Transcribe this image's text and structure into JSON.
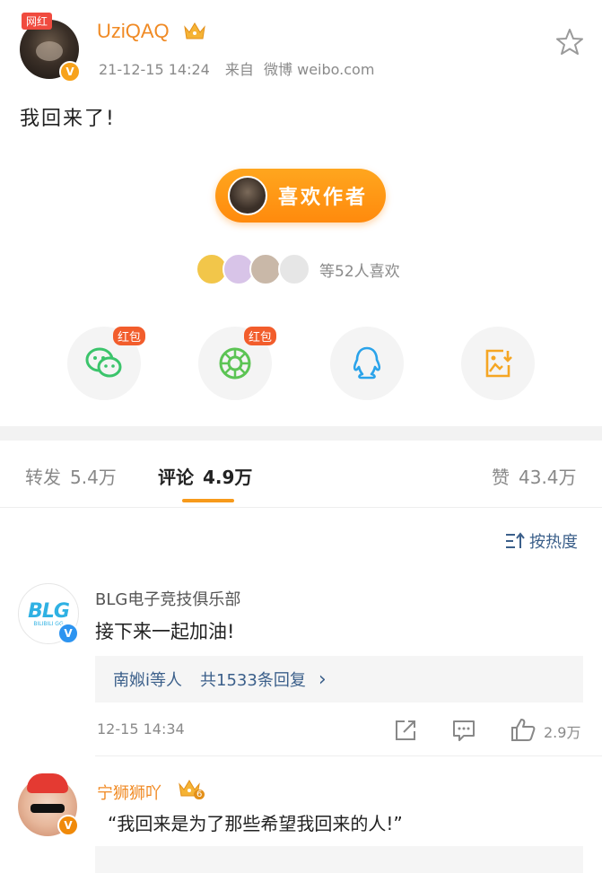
{
  "post": {
    "badge": "网红",
    "username": "UziQAQ",
    "datetime": "21-12-15 14:24",
    "source_prefix": "来自",
    "source": "微博 weibo.com",
    "text": "我回来了!",
    "like_author_label": "喜欢作者",
    "likers_text": "等52人喜欢",
    "hongbao_label_1": "红包",
    "hongbao_label_2": "红包",
    "verified_mark": "V"
  },
  "tabs": [
    {
      "label": "转发",
      "count": "5.4万"
    },
    {
      "label": "评论",
      "count": "4.9万"
    },
    {
      "label": "赞",
      "count": "43.4万"
    }
  ],
  "sort_label": "按热度",
  "comments": [
    {
      "name": "BLG电子竞技俱乐部",
      "logo_text": "BLG",
      "logo_sub": "BILIBILI GG",
      "text": "接下来一起加油!",
      "reply_preview": "南娰i等人",
      "reply_count": "共1533条回复",
      "reply_arrow": "›",
      "time": "12-15 14:34",
      "likes": "2.9万",
      "verified_mark": "V"
    },
    {
      "name": "宁狮狮吖",
      "level": "6",
      "text": "“我回来是为了那些希望我回来的人!”",
      "verified_mark": "V"
    }
  ],
  "colors": {
    "accent_orange": "#f79a1b",
    "username_orange": "#f08a24",
    "link_blue": "#3b5f8a",
    "hongbao_red": "#f25d2c"
  }
}
